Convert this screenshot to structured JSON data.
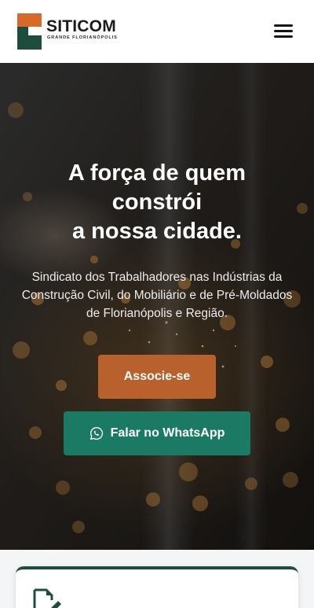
{
  "header": {
    "logo_name": "SITICOM",
    "logo_subtitle": "GRANDE FLORIANÓPOLIS",
    "menu_icon": "hamburger-menu-icon"
  },
  "hero": {
    "title_lines": [
      "A força de quem",
      "constrói",
      "a nossa cidade."
    ],
    "description": "Sindicato dos Trabalhadores nas Indústrias da Construção Civil, do Mobiliário e de Pré-Moldados de Florianópolis e Região.",
    "join_button": "Associe-se",
    "whatsapp_button": "Falar no WhatsApp",
    "whatsapp_icon": "whatsapp-icon"
  },
  "card": {
    "icon": "edit-document-icon"
  },
  "colors": {
    "brand_orange": "#d8692b",
    "brand_green": "#1d4d3c",
    "join_button": "#b8612c",
    "whatsapp_button": "#1b7a63"
  }
}
